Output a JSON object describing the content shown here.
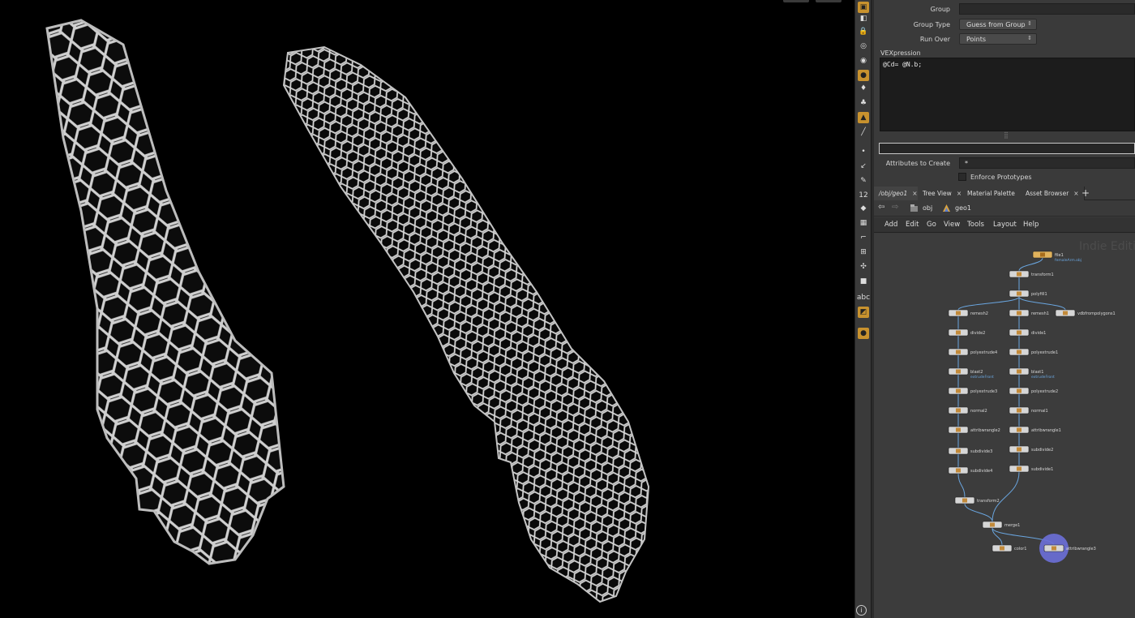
{
  "parameters": {
    "group_label": "Group",
    "group_value": "",
    "group_type_label": "Group Type",
    "group_type_value": "Guess from Group",
    "run_over_label": "Run Over",
    "run_over_value": "Points",
    "vexpression_label": "VEXpression",
    "vexpression_code": "@Cd= @N.b;",
    "attributes_to_create_label": "Attributes to Create",
    "attributes_to_create_value": "*",
    "enforce_prototypes_label": "Enforce Prototypes"
  },
  "network": {
    "tabs": [
      {
        "label": "/obj/geo1",
        "close": "×"
      },
      {
        "label": "Tree View",
        "close": "×"
      },
      {
        "label": "Material Palette",
        "close": "×"
      },
      {
        "label": "Asset Browser",
        "close": "×"
      }
    ],
    "add_tab": "+",
    "path": [
      {
        "label": "obj",
        "icon": "obj-context-icon"
      },
      {
        "label": "geo1",
        "icon": "geo-node-icon"
      }
    ],
    "menu": [
      "Add",
      "Edit",
      "Go",
      "View",
      "Tools",
      "Layout",
      "Help"
    ],
    "watermark": "Indie Edition",
    "nodes": [
      {
        "name": "file1",
        "sub": "femaleArm.obj"
      },
      {
        "name": "transform1",
        "sub": ""
      },
      {
        "name": "polyfill1",
        "sub": ""
      },
      {
        "name": "remesh2",
        "sub": ""
      },
      {
        "name": "remesh1",
        "sub": ""
      },
      {
        "name": "vdbfrompolygons1",
        "sub": ""
      },
      {
        "name": "divide2",
        "sub": ""
      },
      {
        "name": "divide1",
        "sub": ""
      },
      {
        "name": "polyextrude4",
        "sub": ""
      },
      {
        "name": "polyextrude1",
        "sub": ""
      },
      {
        "name": "blast2",
        "sub": "extrudeFront"
      },
      {
        "name": "blast1",
        "sub": "extrudeFront"
      },
      {
        "name": "polyextrude3",
        "sub": ""
      },
      {
        "name": "polyextrude2",
        "sub": ""
      },
      {
        "name": "normal2",
        "sub": ""
      },
      {
        "name": "normal1",
        "sub": ""
      },
      {
        "name": "attribwrangle2",
        "sub": ""
      },
      {
        "name": "attribwrangle1",
        "sub": ""
      },
      {
        "name": "subdivide3",
        "sub": ""
      },
      {
        "name": "subdivide2",
        "sub": ""
      },
      {
        "name": "subdivide4",
        "sub": ""
      },
      {
        "name": "subdivide1",
        "sub": ""
      },
      {
        "name": "transform2",
        "sub": ""
      },
      {
        "name": "merge1",
        "sub": ""
      },
      {
        "name": "color1",
        "sub": ""
      },
      {
        "name": "attribwrangle3",
        "sub": ""
      }
    ]
  },
  "toolbar": {
    "icons": [
      "select-icon",
      "view-icon",
      "lock-icon",
      "snap-icon",
      "ghost-icon",
      "light-icon",
      "pivot-icon",
      "handle-icon",
      "camera-icon",
      "ruler-icon",
      "point-icon",
      "edge-icon",
      "brush-icon",
      "number-icon",
      "paint-icon",
      "scale-icon",
      "corner-icon",
      "grid-icon",
      "tweak-icon",
      "box-icon",
      "text-icon",
      "display-icon",
      "bulb-icon"
    ],
    "abc_label": "abc",
    "number_label": "12",
    "info_label": "i"
  },
  "colors": {
    "accent": "#c8922e",
    "panel": "#3a3a3a",
    "viewport": "#000000",
    "wire": "#6aa6e0",
    "mesh": "#d0d0d0"
  }
}
